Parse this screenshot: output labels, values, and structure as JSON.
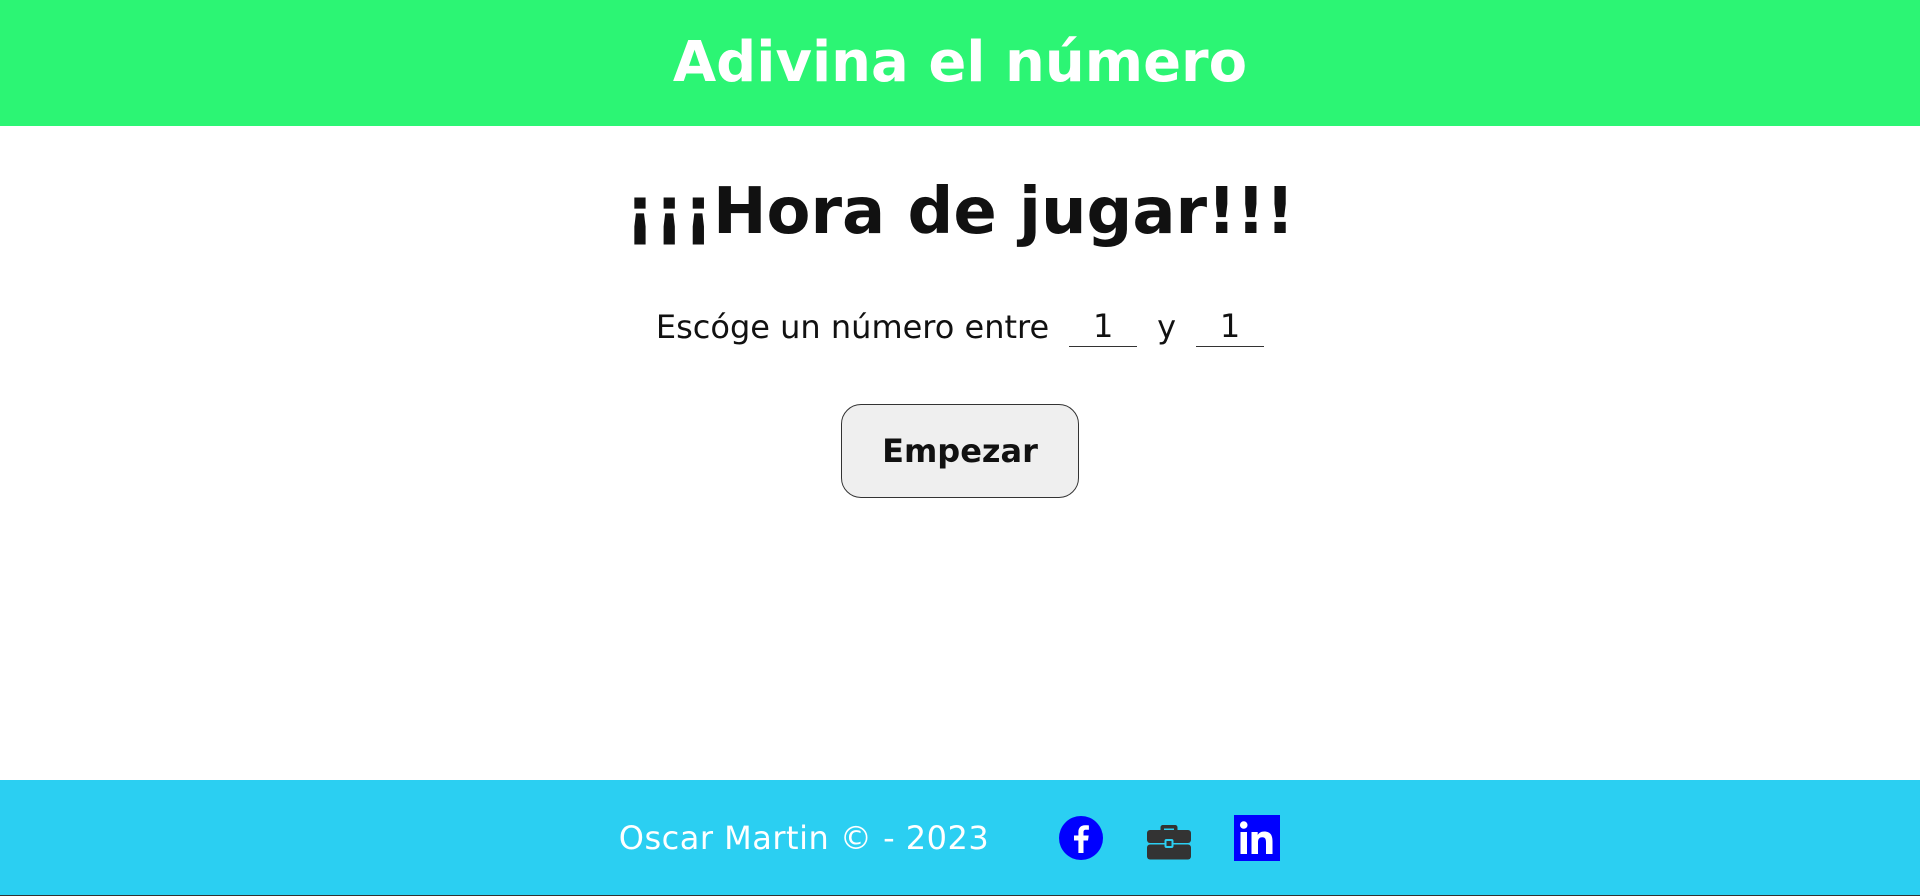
{
  "header": {
    "title": "Adivina el número"
  },
  "main": {
    "heading": "¡¡¡Hora de jugar!!!",
    "range_prompt": "Escóge un número entre",
    "range_separator": "y",
    "min_value": "1",
    "max_value": "1",
    "start_button_label": "Empezar"
  },
  "footer": {
    "copyright": "Oscar Martin © - 2023",
    "social_links": [
      {
        "icon": "facebook-icon",
        "color": "#0000ff"
      },
      {
        "icon": "briefcase-icon",
        "color": "#333333"
      },
      {
        "icon": "linkedin-icon",
        "color": "#0000ff"
      }
    ]
  },
  "colors": {
    "header_bg": "#2cf574",
    "footer_bg": "#2bcff2",
    "button_bg": "#efefef",
    "link_blue": "#0000ff"
  }
}
